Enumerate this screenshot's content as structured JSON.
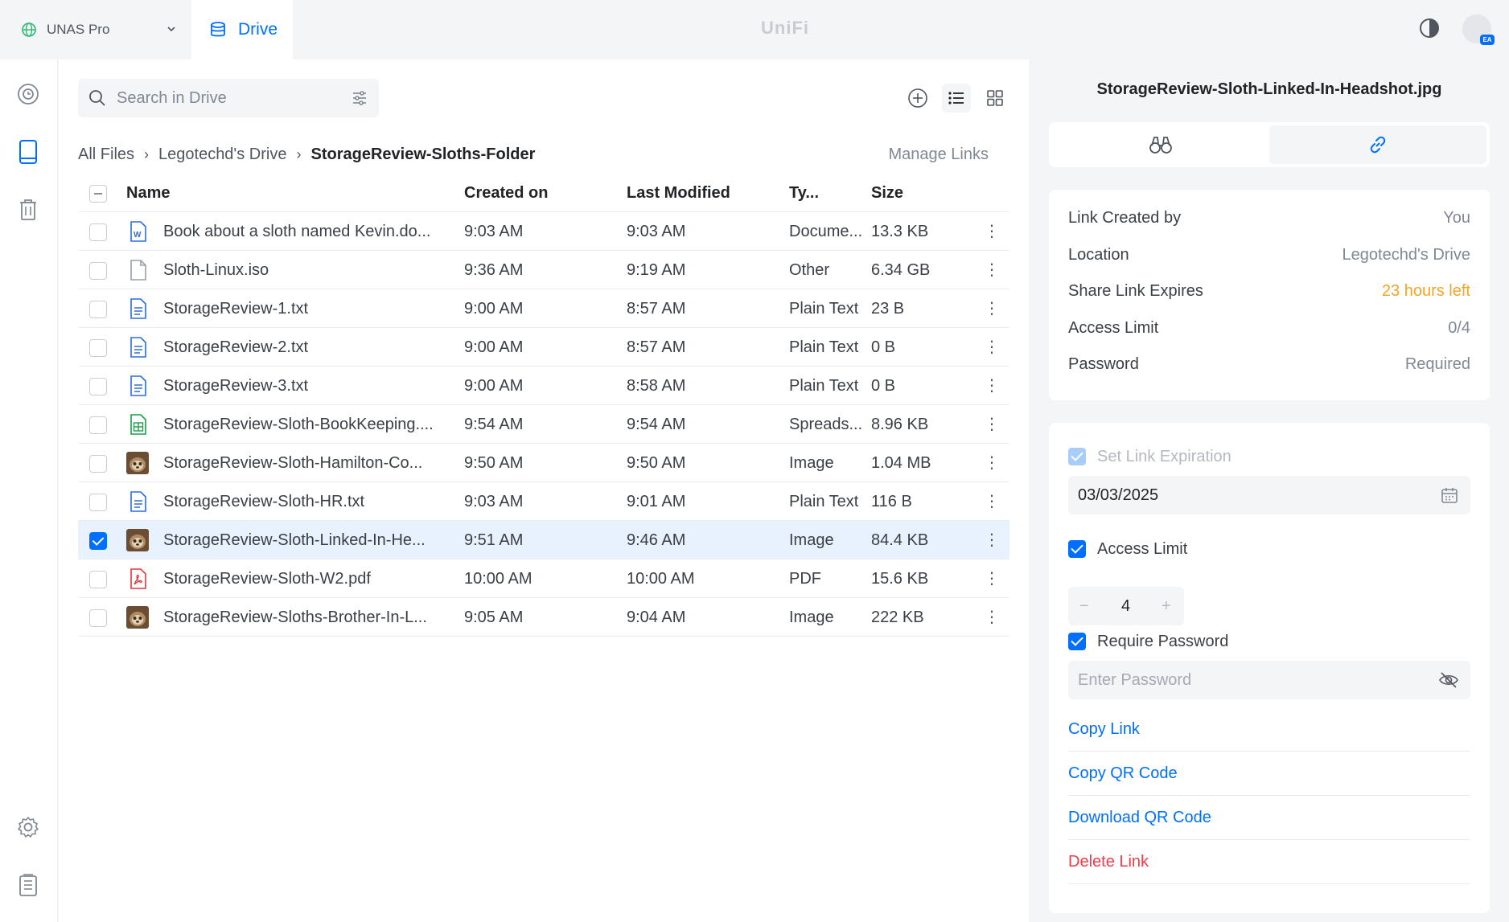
{
  "topbar": {
    "console_name": "UNAS Pro",
    "app_tab": "Drive",
    "brand": "UniFi",
    "avatar_badge": "EA"
  },
  "search": {
    "placeholder": "Search in Drive"
  },
  "breadcrumb": [
    "All Files",
    "Legotechd's Drive",
    "StorageReview-Sloths-Folder"
  ],
  "manage_links": "Manage Links",
  "columns": {
    "name": "Name",
    "created": "Created on",
    "modified": "Last Modified",
    "type": "Ty...",
    "size": "Size"
  },
  "files": [
    {
      "name": "Book about a sloth named Kevin.do...",
      "created": "9:03 AM",
      "modified": "9:03 AM",
      "type": "Docume...",
      "size": "13.3 KB",
      "icon": "word-doc-icon",
      "selected": false
    },
    {
      "name": "Sloth-Linux.iso",
      "created": "9:36 AM",
      "modified": "9:19 AM",
      "type": "Other",
      "size": "6.34 GB",
      "icon": "file-icon",
      "selected": false
    },
    {
      "name": "StorageReview-1.txt",
      "created": "9:00 AM",
      "modified": "8:57 AM",
      "type": "Plain Text",
      "size": "23 B",
      "icon": "text-file-icon",
      "selected": false
    },
    {
      "name": "StorageReview-2.txt",
      "created": "9:00 AM",
      "modified": "8:57 AM",
      "type": "Plain Text",
      "size": "0 B",
      "icon": "text-file-icon",
      "selected": false
    },
    {
      "name": "StorageReview-3.txt",
      "created": "9:00 AM",
      "modified": "8:58 AM",
      "type": "Plain Text",
      "size": "0 B",
      "icon": "text-file-icon",
      "selected": false
    },
    {
      "name": "StorageReview-Sloth-BookKeeping....",
      "created": "9:54 AM",
      "modified": "9:54 AM",
      "type": "Spreads...",
      "size": "8.96 KB",
      "icon": "spreadsheet-icon",
      "selected": false
    },
    {
      "name": "StorageReview-Sloth-Hamilton-Co...",
      "created": "9:50 AM",
      "modified": "9:50 AM",
      "type": "Image",
      "size": "1.04 MB",
      "icon": "image-thumbnail-icon",
      "selected": false
    },
    {
      "name": "StorageReview-Sloth-HR.txt",
      "created": "9:03 AM",
      "modified": "9:01 AM",
      "type": "Plain Text",
      "size": "116 B",
      "icon": "text-file-icon",
      "selected": false
    },
    {
      "name": "StorageReview-Sloth-Linked-In-He...",
      "created": "9:51 AM",
      "modified": "9:46 AM",
      "type": "Image",
      "size": "84.4 KB",
      "icon": "image-thumbnail-icon",
      "selected": true
    },
    {
      "name": "StorageReview-Sloth-W2.pdf",
      "created": "10:00 AM",
      "modified": "10:00 AM",
      "type": "PDF",
      "size": "15.6 KB",
      "icon": "pdf-icon",
      "selected": false
    },
    {
      "name": "StorageReview-Sloths-Brother-In-L...",
      "created": "9:05 AM",
      "modified": "9:04 AM",
      "type": "Image",
      "size": "222 KB",
      "icon": "image-thumbnail-icon",
      "selected": false
    }
  ],
  "panel": {
    "title": "StorageReview-Sloth-Linked-In-Headshot.jpg",
    "info": [
      {
        "key": "Link Created by",
        "value": "You"
      },
      {
        "key": "Location",
        "value": "Legotechd's Drive"
      },
      {
        "key": "Share Link Expires",
        "value": "23 hours left"
      },
      {
        "key": "Access Limit",
        "value": "0/4"
      },
      {
        "key": "Password",
        "value": "Required"
      }
    ],
    "set_expiration_label": "Set Link Expiration",
    "expiration_date": "03/03/2025",
    "access_limit_label": "Access Limit",
    "access_limit_value": "4",
    "require_password_label": "Require Password",
    "password_placeholder": "Enter Password",
    "actions": [
      "Copy Link",
      "Copy QR Code",
      "Download QR Code",
      "Delete Link"
    ]
  },
  "colors": {
    "accent": "#006fff",
    "warning": "#f5a524",
    "danger": "#f03a47"
  }
}
